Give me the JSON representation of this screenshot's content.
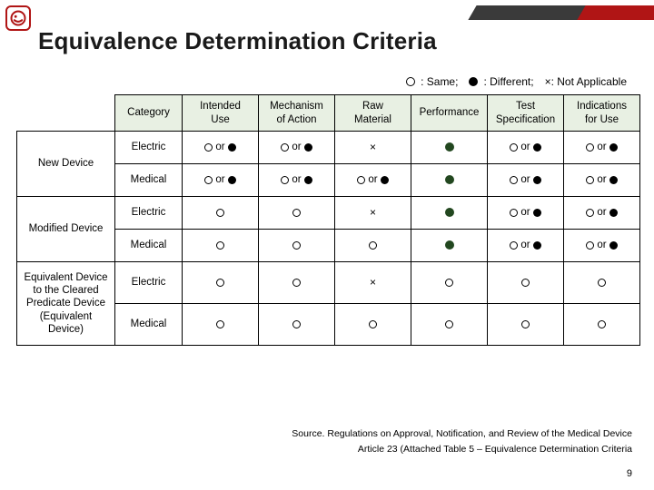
{
  "title": "Equivalence Determination Criteria",
  "legend": {
    "same": ": Same;",
    "different": ": Different;",
    "na": "×: Not Applicable"
  },
  "columns": {
    "category": "Category",
    "c1a": "Intended",
    "c1b": "Use",
    "c2a": "Mechanism",
    "c2b": "of Action",
    "c3a": "Raw",
    "c3b": "Material",
    "c4": "Performance",
    "c5a": "Test",
    "c5b": "Specification",
    "c6a": "Indications",
    "c6b": "for Use"
  },
  "rowgroups": [
    {
      "label": "New Device",
      "rows": [
        "Electric",
        "Medical"
      ]
    },
    {
      "label": "Modified Device",
      "rows": [
        "Electric",
        "Medical"
      ]
    },
    {
      "label": "Equivalent Device to the Cleared Predicate Device (Equivalent Device)",
      "rows": [
        "Electric",
        "Medical"
      ]
    }
  ],
  "cells": {
    "g0r0": [
      "oor",
      "oor",
      "x",
      "gfill",
      "oor",
      "oor"
    ],
    "g0r1": [
      "oor",
      "oor",
      "oor",
      "gfill",
      "oor",
      "oor"
    ],
    "g1r0": [
      "open",
      "open",
      "x",
      "gfill",
      "oor",
      "oor"
    ],
    "g1r1": [
      "open",
      "open",
      "open",
      "gfill",
      "oor",
      "oor"
    ],
    "g2r0": [
      "open",
      "open",
      "x",
      "open",
      "open",
      "open"
    ],
    "g2r1": [
      "open",
      "open",
      "open",
      "open",
      "open",
      "open"
    ]
  },
  "footer": {
    "l1": "Source. Regulations on Approval, Notification, and Review of the Medical Device",
    "l2": "Article 23 (Attached Table 5 – Equivalence Determination Criteria"
  },
  "pagenum": "9",
  "chart_data": {
    "type": "table",
    "title": "Equivalence Determination Criteria",
    "legend": {
      "○": "Same",
      "●": "Different",
      "×": "Not Applicable"
    },
    "columns": [
      "Intended Use",
      "Mechanism of Action",
      "Raw Material",
      "Performance",
      "Test Specification",
      "Indications for Use"
    ],
    "rows": [
      {
        "group": "New Device",
        "category": "Electric",
        "values": [
          "○ or ●",
          "○ or ●",
          "×",
          "●",
          "○ or ●",
          "○ or ●"
        ]
      },
      {
        "group": "New Device",
        "category": "Medical",
        "values": [
          "○ or ●",
          "○ or ●",
          "○ or ●",
          "●",
          "○ or ●",
          "○ or ●"
        ]
      },
      {
        "group": "Modified Device",
        "category": "Electric",
        "values": [
          "○",
          "○",
          "×",
          "●",
          "○ or ●",
          "○ or ●"
        ]
      },
      {
        "group": "Modified Device",
        "category": "Medical",
        "values": [
          "○",
          "○",
          "○",
          "●",
          "○ or ●",
          "○ or ●"
        ]
      },
      {
        "group": "Equivalent Device to the Cleared Predicate Device (Equivalent Device)",
        "category": "Electric",
        "values": [
          "○",
          "○",
          "×",
          "○",
          "○",
          "○"
        ]
      },
      {
        "group": "Equivalent Device to the Cleared Predicate Device (Equivalent Device)",
        "category": "Medical",
        "values": [
          "○",
          "○",
          "○",
          "○",
          "○",
          "○"
        ]
      }
    ]
  }
}
